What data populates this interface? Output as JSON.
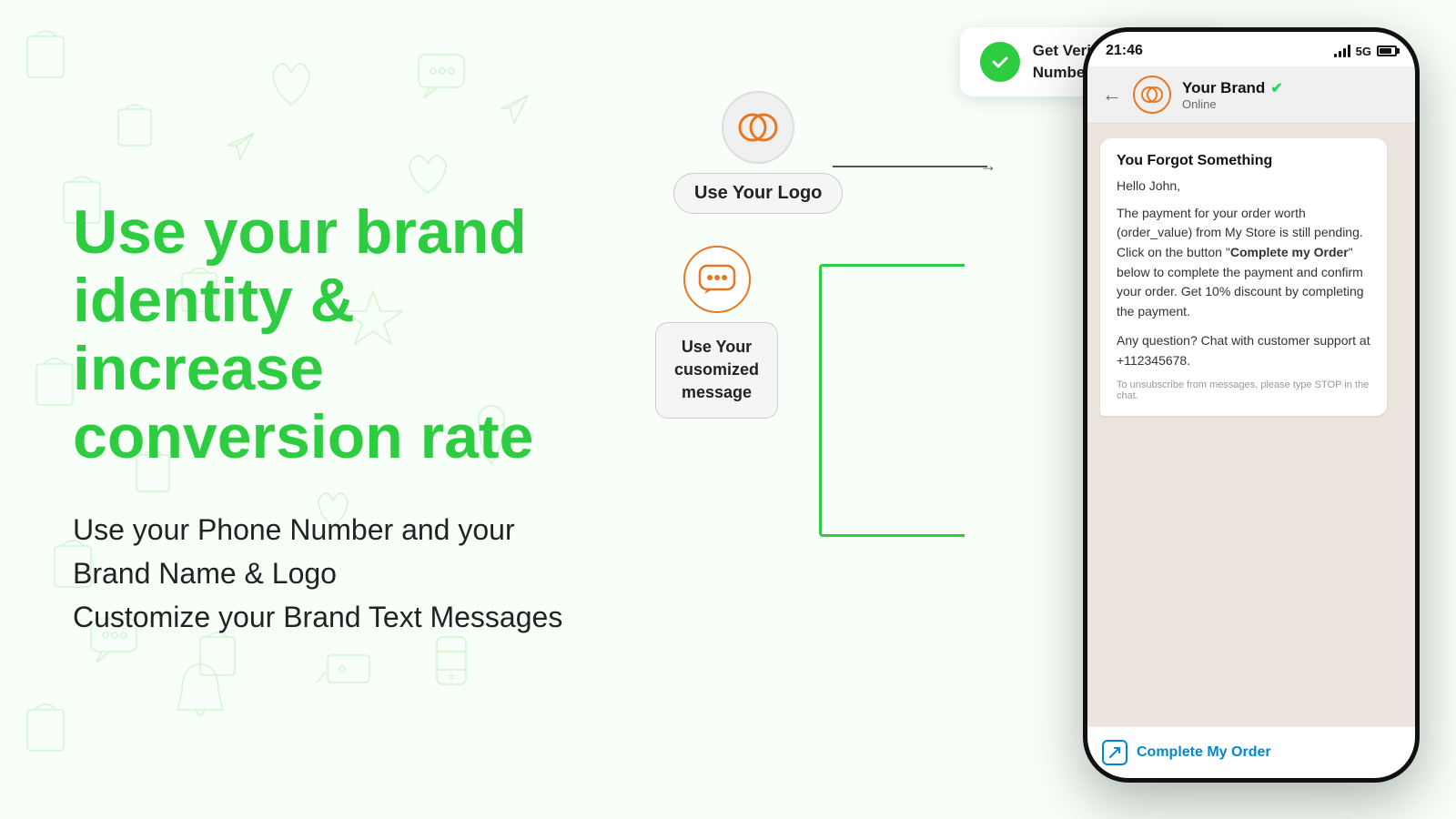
{
  "page": {
    "bg_color": "#f8fff8"
  },
  "left": {
    "heading_line1": "Use your brand",
    "heading_line2": "identity & increase",
    "heading_line3": "conversion rate",
    "subtext_line1": "Use your Phone Number and your",
    "subtext_line2": "Brand Name & Logo",
    "subtext_line3": "Customize your Brand Text Messages"
  },
  "callouts": {
    "logo_label": "Use Your Logo",
    "message_label_line1": "Use Your",
    "message_label_line2": "cusomized",
    "message_label_line3": "message",
    "verified_line1": "Get Verified WhatsApp",
    "verified_line2": "Number & Green Tick"
  },
  "phone": {
    "time": "21:46",
    "signal_label": "5G",
    "brand_name": "Your Brand",
    "online_status": "Online",
    "bubble_title": "You Forgot Something",
    "bubble_greeting": "Hello John,",
    "bubble_body": "The payment for your order worth (order_value) from My Store is still pending. Click on the button “Complete my Order” below to complete the payment and confirm your order. Get 10% discount by completing the payment.",
    "bubble_support": "Any question? Chat with customer support at +112345678.",
    "unsubscribe": "To unsubscribe from messages, please type STOP in the chat.",
    "cta_label": "Complete My Order"
  }
}
